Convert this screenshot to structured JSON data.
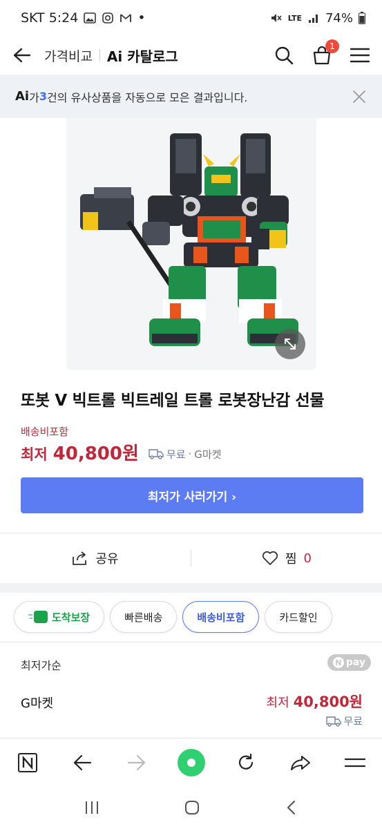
{
  "status_bar": {
    "carrier_time": "SKT 5:24",
    "dot": "•",
    "network": "LTE",
    "battery": "74%"
  },
  "header": {
    "title_1": "가격비교",
    "title_2": "Ai 카탈로그",
    "cart_count": "1"
  },
  "ai_banner": {
    "logo": "Ai",
    "text_pre": "가 ",
    "count": "3",
    "text_post": "건의 유사상품을 자동으로 모은 결과입니다."
  },
  "product": {
    "title": "또봇 V 빅트롤 빅트레일 트롤 로봇장난감 선물",
    "ship_note": "배송비포함",
    "price_prefix": "최저",
    "price": "40,800원",
    "shipping": "무료",
    "separator": "·",
    "shop": "G마켓",
    "buy_button": "최저가 사러가기 ›"
  },
  "actions": {
    "share": "공유",
    "like": "찜",
    "like_count": "0"
  },
  "chips": [
    {
      "label": "도착보장",
      "badge": "N"
    },
    {
      "label": "빠른배송"
    },
    {
      "label": "배송비포함"
    },
    {
      "label": "카드할인"
    }
  ],
  "sort": {
    "label": "최저가순",
    "npay": "pay",
    "npay_n": "N"
  },
  "offer": {
    "seller": "G마켓",
    "price_prefix": "최저",
    "price": "40,800원",
    "shipping": "무료"
  },
  "colors": {
    "accent_blue": "#5b7cf2",
    "price_red": "#c0283a",
    "home_green": "#2fd072"
  }
}
